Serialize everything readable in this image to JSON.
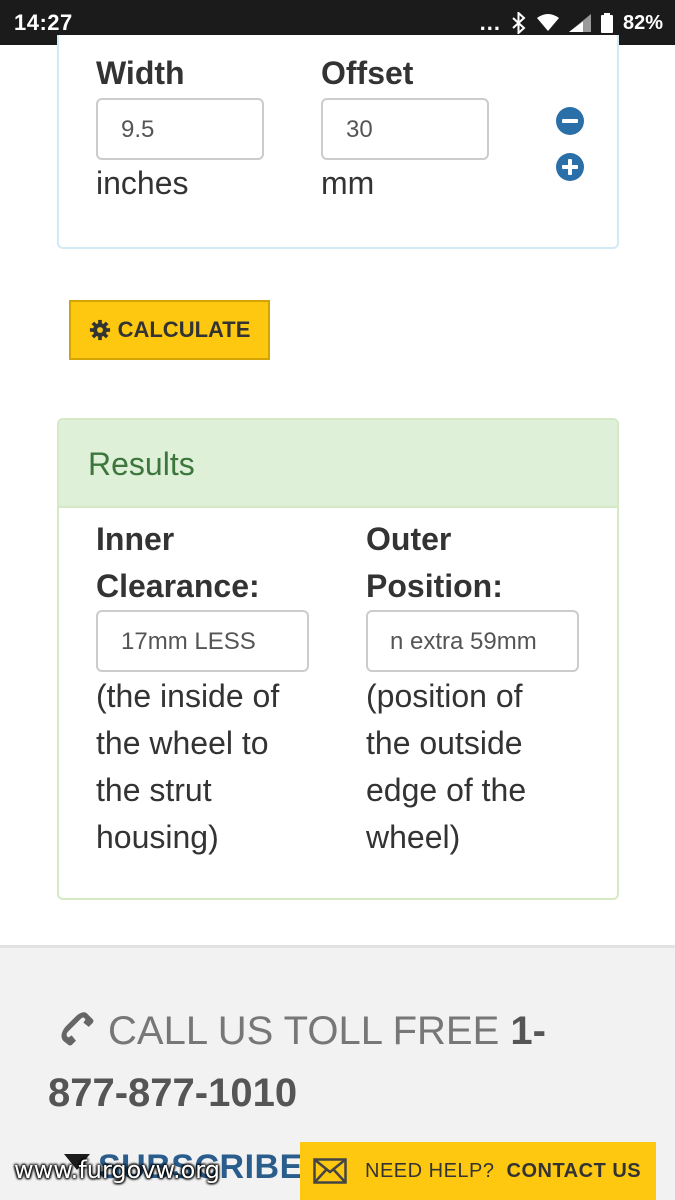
{
  "status_bar": {
    "time": "14:27",
    "dots": "...",
    "battery_percent": "82%"
  },
  "wheel_form": {
    "width_label": "Width",
    "width_value": "9.5",
    "width_unit": "inches",
    "offset_label": "Offset",
    "offset_value": "30",
    "offset_unit": "mm"
  },
  "calculate_button": {
    "label": "CALCULATE",
    "icon": "gear-icon"
  },
  "results": {
    "title": "Results",
    "inner": {
      "title_line1": "Inner",
      "title_line2": "Clearance:",
      "value": "17mm LESS",
      "desc_lines": [
        "(the inside of",
        "the wheel to",
        "the strut",
        "housing)"
      ]
    },
    "outer": {
      "title_line1": "Outer",
      "title_line2": "Position:",
      "value": "n extra 59mm",
      "desc_lines": [
        "(position of",
        "the outside",
        "edge of the",
        "wheel)"
      ]
    }
  },
  "footer": {
    "call_lead": "CALL US TOLL FREE",
    "call_number_part1": "1-",
    "call_number_part2": "877-877-1010",
    "subscribe_label": "SUBSCRIBE T",
    "watermark": "www.furgovw.org"
  },
  "help_bar": {
    "need_help": "NEED HELP?",
    "contact_us": "CONTACT US"
  },
  "colors": {
    "accent_yellow": "#fec810",
    "results_header_bg": "#dff0d8",
    "results_title": "#3c763d",
    "stepper_blue": "#2a6fa8",
    "subscribe_blue": "#2a5d8c"
  }
}
